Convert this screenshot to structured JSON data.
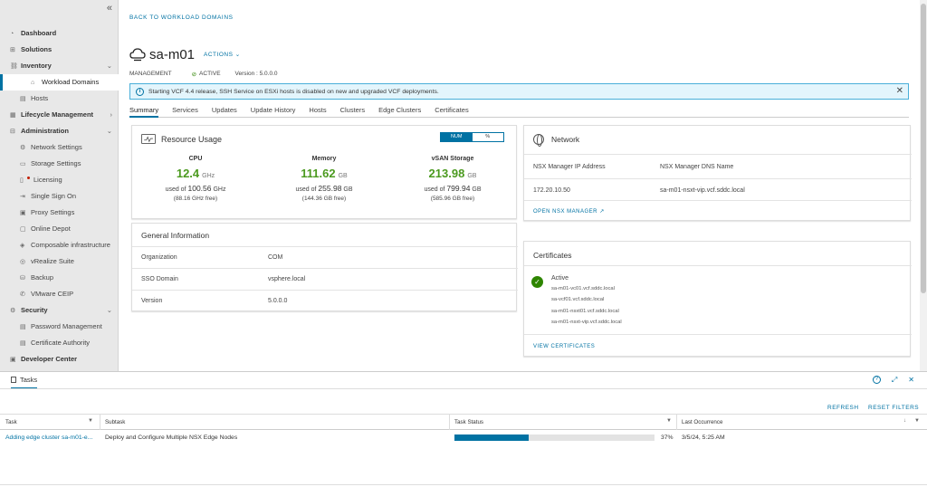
{
  "sidebar": {
    "collapse_icon": "«",
    "items": [
      {
        "label": "Dashboard",
        "icon": "dashboard-icon"
      },
      {
        "label": "Solutions",
        "icon": "solutions-icon"
      },
      {
        "label": "Inventory",
        "icon": "inventory-icon"
      },
      {
        "label": "Workload Domains",
        "icon": "domains-icon"
      },
      {
        "label": "Hosts",
        "icon": "hosts-icon"
      },
      {
        "label": "Lifecycle Management",
        "icon": "lifecycle-icon"
      },
      {
        "label": "Administration",
        "icon": "admin-icon"
      },
      {
        "label": "Network Settings",
        "icon": "network-icon"
      },
      {
        "label": "Storage Settings",
        "icon": "storage-icon"
      },
      {
        "label": "Licensing",
        "icon": "license-icon"
      },
      {
        "label": "Single Sign On",
        "icon": "sso-icon"
      },
      {
        "label": "Proxy Settings",
        "icon": "proxy-icon"
      },
      {
        "label": "Online Depot",
        "icon": "depot-icon"
      },
      {
        "label": "Composable infrastructure",
        "icon": "composable-icon"
      },
      {
        "label": "vRealize Suite",
        "icon": "vrealize-icon"
      },
      {
        "label": "Backup",
        "icon": "backup-icon"
      },
      {
        "label": "VMware CEIP",
        "icon": "ceip-icon"
      },
      {
        "label": "Security",
        "icon": "security-icon"
      },
      {
        "label": "Password Management",
        "icon": "password-icon"
      },
      {
        "label": "Certificate Authority",
        "icon": "ca-icon"
      },
      {
        "label": "Developer Center",
        "icon": "developer-icon"
      }
    ]
  },
  "header": {
    "back_link": "BACK TO WORKLOAD DOMAINS",
    "title": "sa-m01",
    "actions": "ACTIONS",
    "type": "MANAGEMENT",
    "status": "ACTIVE",
    "version": "Version : 5.0.0.0"
  },
  "banner": {
    "text": "Starting VCF 4.4 release, SSH Service on ESXi hosts is disabled on new and upgraded VCF deployments."
  },
  "tabs": [
    "Summary",
    "Services",
    "Updates",
    "Update History",
    "Hosts",
    "Clusters",
    "Edge Clusters",
    "Certificates"
  ],
  "resource_usage": {
    "title": "Resource Usage",
    "toggle": [
      "NUM",
      "%"
    ],
    "metrics": [
      {
        "label": "CPU",
        "value": "12.4",
        "unit": "GHz",
        "used_prefix": "used of",
        "total": "100.56",
        "total_unit": "GHz",
        "free": "(88.16 GHz free)"
      },
      {
        "label": "Memory",
        "value": "111.62",
        "unit": "GB",
        "used_prefix": "used of",
        "total": "255.98",
        "total_unit": "GB",
        "free": "(144.36 GB free)"
      },
      {
        "label": "vSAN Storage",
        "value": "213.98",
        "unit": "GB",
        "used_prefix": "used of",
        "total": "799.94",
        "total_unit": "GB",
        "free": "(585.96 GB free)"
      }
    ]
  },
  "general": {
    "title": "General Information",
    "rows": [
      {
        "k": "Organization",
        "v": "COM"
      },
      {
        "k": "SSO Domain",
        "v": "vsphere.local"
      },
      {
        "k": "Version",
        "v": "5.0.0.0"
      }
    ]
  },
  "network": {
    "title": "Network",
    "col1": "NSX Manager IP Address",
    "col2": "NSX Manager DNS Name",
    "ip": "172.20.10.50",
    "dns": "sa-m01-nsxt-vip.vcf.sddc.local",
    "link": "OPEN NSX MANAGER"
  },
  "certificates": {
    "title": "Certificates",
    "status": "Active",
    "hosts": [
      "sa-m01-vc01.vcf.sddc.local",
      "sa-vcf01.vcf.sddc.local",
      "sa-m01-nsxt01.vcf.sddc.local",
      "sa-m01-nsxt-vip.vcf.sddc.local"
    ],
    "link": "VIEW CERTIFICATES"
  },
  "tasks": {
    "tab": "Tasks",
    "refresh": "REFRESH",
    "reset": "RESET FILTERS",
    "columns": [
      "Task",
      "Subtask",
      "Task Status",
      "Last Occurrence"
    ],
    "rows": [
      {
        "task": "Adding edge cluster sa-m01-e...",
        "subtask": "Deploy and Configure Multiple NSX Edge Nodes",
        "progress": 37,
        "progress_label": "37%",
        "occurrence": "3/5/24, 5:25 AM"
      }
    ]
  },
  "colors": {
    "accent": "#0072a3",
    "success": "#4b9a1f",
    "banner_bg": "#e3f5fc"
  }
}
